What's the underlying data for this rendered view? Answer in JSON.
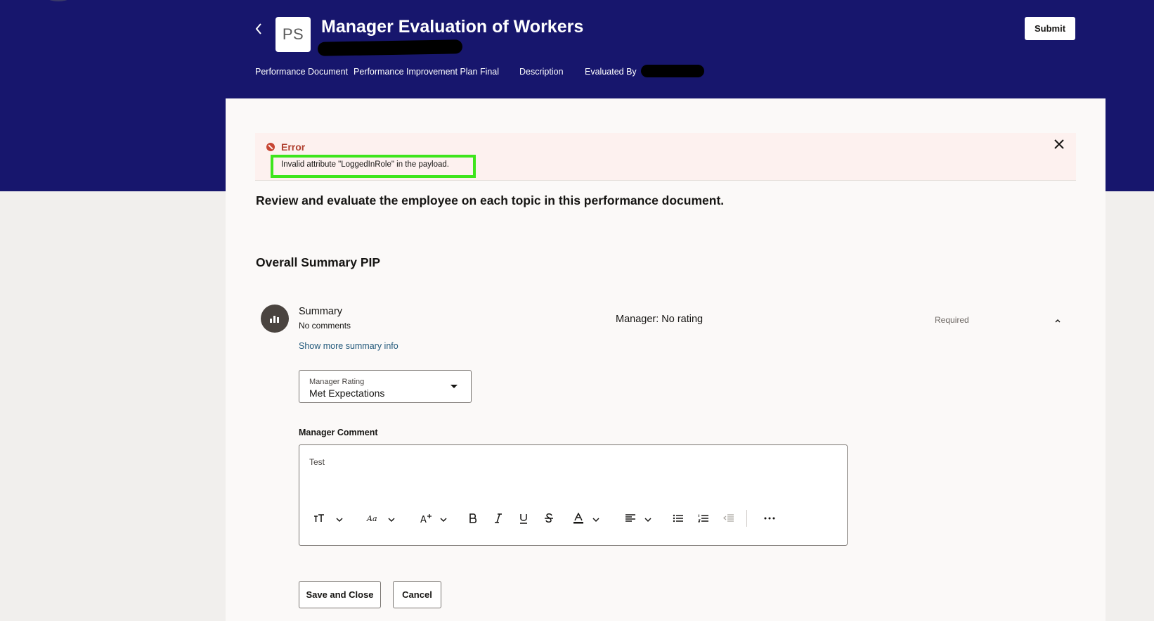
{
  "header": {
    "badge": "PS",
    "title": "Manager Evaluation of Workers",
    "submit_label": "Submit",
    "meta": {
      "performance_document_label": "Performance Document",
      "performance_document_value": "Performance Improvement Plan Final",
      "description_label": "Description",
      "evaluated_by_label": "Evaluated By"
    }
  },
  "error": {
    "title": "Error",
    "message": "Invalid attribute \"LoggedInRole\" in the payload."
  },
  "main": {
    "instructions": "Review and evaluate the employee on each topic in this performance document.",
    "section_title": "Overall Summary PIP",
    "summary": {
      "title": "Summary",
      "subtitle": "No comments",
      "manager_rating_status": "Manager: No rating",
      "required": "Required",
      "show_more": "Show more summary info"
    },
    "manager_rating": {
      "label": "Manager Rating",
      "value": "Met Expectations"
    },
    "manager_comment": {
      "label": "Manager Comment",
      "value": "Test"
    },
    "actions": {
      "save_close": "Save and Close",
      "cancel": "Cancel"
    }
  },
  "colors": {
    "header_bg": "#17166d",
    "error_bg": "#fdf1ef",
    "error_accent": "#c74634",
    "highlight": "#3ee51c",
    "link": "#22597b"
  }
}
